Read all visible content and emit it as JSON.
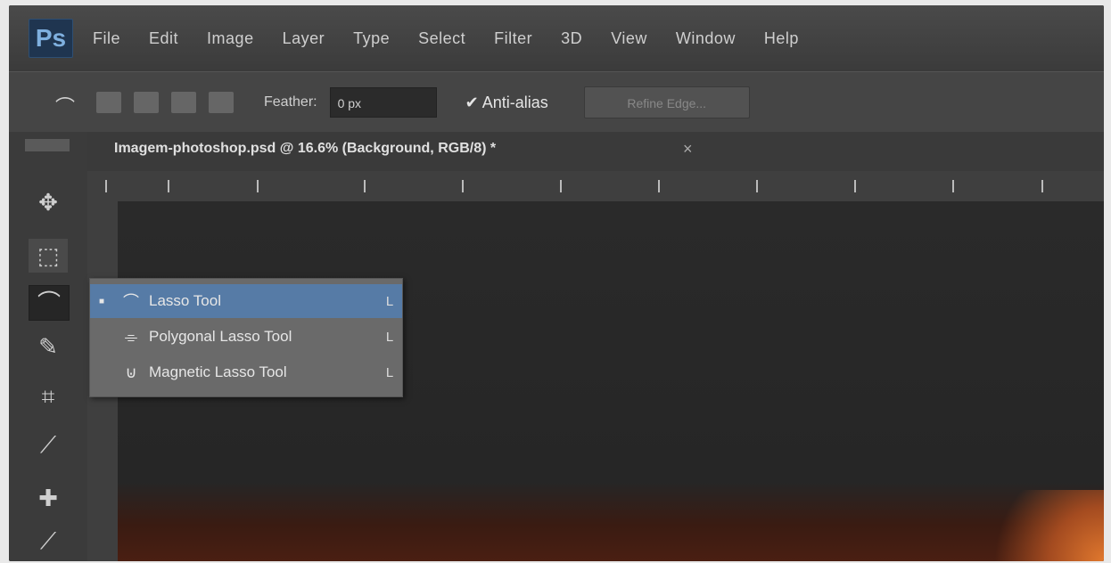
{
  "menubar": {
    "logo": "Ps",
    "items": [
      "File",
      "Edit",
      "Image",
      "Layer",
      "Type",
      "Select",
      "Filter",
      "3D",
      "View",
      "Window",
      "Help"
    ]
  },
  "options_bar": {
    "feather_label": "Feather:",
    "feather_value": "0 px",
    "anti_alias_label": "Anti-alias",
    "refine_edge_label": "Refine Edge..."
  },
  "document": {
    "tab_title": "Imagem-photoshop.psd @ 16.6% (Background, RGB/8) *",
    "close_glyph": "×"
  },
  "tool_flyout": {
    "items": [
      {
        "label": "Lasso Tool",
        "shortcut": "L",
        "icon": "lasso-icon",
        "selected": true
      },
      {
        "label": "Polygonal Lasso Tool",
        "shortcut": "L",
        "icon": "polygonal-lasso-icon",
        "selected": false
      },
      {
        "label": "Magnetic Lasso Tool",
        "shortcut": "L",
        "icon": "magnetic-lasso-icon",
        "selected": false
      }
    ]
  },
  "colors": {
    "menubar": "#3b3b3b",
    "panel": "#454545",
    "canvas": "#262626",
    "selection_blue": "#567ba6",
    "ps_blue": "#7fb0df"
  }
}
